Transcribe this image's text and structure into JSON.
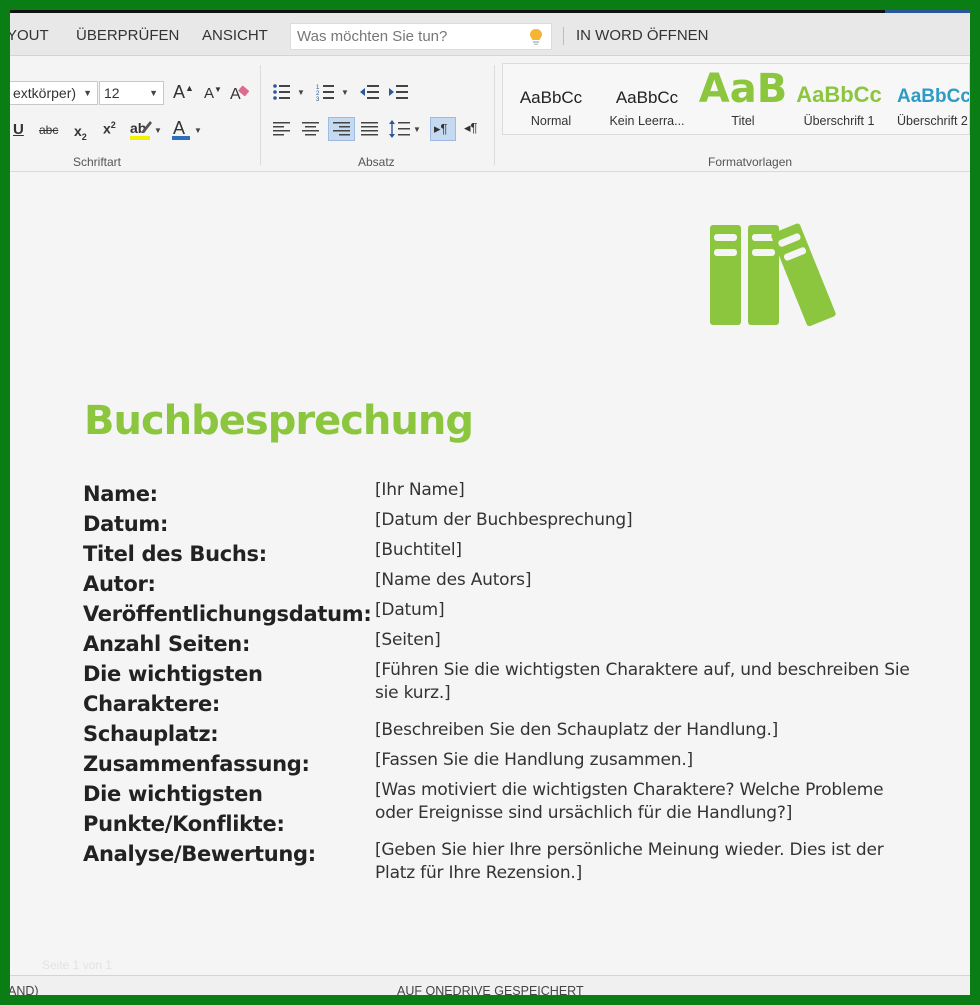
{
  "menubar": {
    "tabs": [
      "YOUT",
      "ÜBERPRÜFEN",
      "ANSICHT"
    ],
    "tell_me_placeholder": "Was möchten Sie tun?",
    "open_in_word": "IN WORD ÖFFNEN"
  },
  "ribbon": {
    "font_name": "extkörper)",
    "font_size": "12",
    "groups": {
      "font": "Schriftart",
      "paragraph": "Absatz",
      "styles": "Formatvorlagen"
    },
    "styles": [
      {
        "sample": "AaBbCc",
        "name": "Normal"
      },
      {
        "sample": "AaBbCc",
        "name": "Kein Leerra..."
      },
      {
        "sample": "AaB",
        "name": "Titel"
      },
      {
        "sample": "AaBbCc",
        "name": "Überschrift 1"
      },
      {
        "sample": "AaBbCc",
        "name": "Überschrift 2"
      }
    ],
    "colors": {
      "highlight": "#f2f200",
      "font_color": "#2f6eba",
      "active_bg": "#c5d9f1"
    }
  },
  "document": {
    "title": "Buchbesprechung",
    "accent_color": "#8cc63f",
    "icon": "books-icon",
    "faint_text": "Seite 1 von 1",
    "fields": [
      {
        "label": "Name:",
        "value": "[Ihr Name]"
      },
      {
        "label": "Datum:",
        "value": "[Datum der Buchbesprechung]"
      },
      {
        "label": "Titel des Buchs:",
        "value": "[Buchtitel]"
      },
      {
        "label": "Autor:",
        "value": "[Name des Autors]"
      },
      {
        "label": "Veröffentlichungsdatum:",
        "value": "[Datum]"
      },
      {
        "label": "Anzahl Seiten:",
        "value": "[Seiten]"
      },
      {
        "label": "Die wichtigsten Charaktere:",
        "value": "[Führen Sie die wichtigsten Charaktere auf, und beschreiben Sie sie kurz.]"
      },
      {
        "label": "Schauplatz:",
        "value": "[Beschreiben Sie den Schauplatz der Handlung.]"
      },
      {
        "label": "Zusammenfassung:",
        "value": "[Fassen Sie die Handlung zusammen.]"
      },
      {
        "label": "Die wichtigsten Punkte/Konflikte:",
        "value": "[Was motiviert die wichtigsten Charaktere? Welche Probleme oder Ereignisse sind ursächlich für die Handlung?]"
      },
      {
        "label": "Analyse/Bewertung:",
        "value": "[Geben Sie hier Ihre persönliche Meinung wieder. Dies ist der Platz für Ihre Rezension.]"
      }
    ]
  },
  "status": {
    "language": "AND)",
    "saved": "AUF ONEDRIVE GESPEICHERT"
  }
}
